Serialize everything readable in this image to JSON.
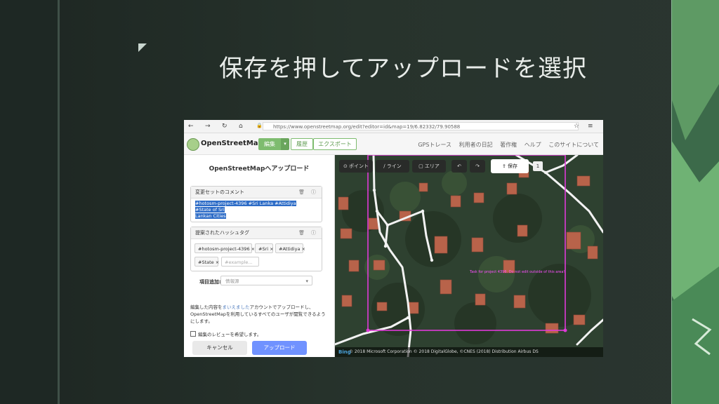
{
  "slide": {
    "title": "保存を押してアップロードを選択"
  },
  "browser": {
    "url": "https://www.openstreetmap.org/edit?editor=id&map=19/6.82332/79.90588",
    "back_icon": "←",
    "forward_icon": "→",
    "reload_icon": "↻",
    "home_icon": "⌂",
    "lock_icon": "🔒",
    "bookmark_icon": "☆",
    "menu_icon": "≡"
  },
  "osm": {
    "brand": "OpenStreetMap",
    "edit_label": "編集",
    "caret": "▾",
    "history_label": "履歴",
    "export_label": "エクスポート",
    "links": [
      "GPSトレース",
      "利用者の日記",
      "著作権",
      "ヘルプ",
      "このサイトについて"
    ]
  },
  "upload_panel": {
    "title": "OpenStreetMapへアップロード",
    "comment_label": "変更セットのコメント",
    "comment_line1": "#hotosm-project-4396 #Sri Lanka #Attidiya #State of Sri",
    "comment_line2": "Lankan Cities",
    "hashtags_label": "提案されたハッシュタグ",
    "tags": [
      "#hotosm-project-4396",
      "#Sri",
      "#Attidiya",
      "#State"
    ],
    "tag_placeholder": "#example...",
    "add_label": "項目追加:",
    "add_placeholder": "情報源",
    "note_pre": "編集した内容を",
    "note_link": "まいえました",
    "note_post": "アカウントでアップロードし、OpenStreetMapを利用しているすべてのユーザが閲覧できるようにします。",
    "review_label": "編集のレビューを希望します。",
    "cancel_label": "キャンセル",
    "upload_label": "アップロード"
  },
  "map_toolbar": {
    "point_label": "ポイント",
    "line_label": "ライン",
    "area_label": "エリア",
    "undo_icon": "↶",
    "redo_icon": "↷",
    "save_label": "保存",
    "save_count": "1"
  },
  "map": {
    "task_label": "Task for project 4396. Do not edit outside of this area!",
    "attribution": "© 2018 Microsoft Corporation  © 2018 DigitalGlobe, ©CNES (2018) Distribution Airbus DS",
    "bing": "Bing"
  },
  "colors": {
    "accent_green": "#7ebc6f",
    "upload_blue": "#7092ff",
    "task_magenta": "#e03ad8"
  }
}
